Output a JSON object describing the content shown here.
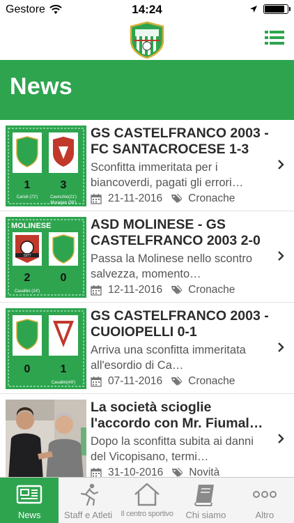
{
  "status_bar": {
    "carrier": "Gestore",
    "time": "14:24",
    "battery_level": 0.9
  },
  "nav_bar": {
    "logo_icon": "club-crest-icon",
    "menu_icon": "list-menu-icon"
  },
  "header": {
    "title": "News"
  },
  "news": [
    {
      "title": "GS CASTELFRANCO 2003 - FC SANTACROCESE  1-3",
      "summary": "Sconfitta immeritata per i biancoverdi, pagati gli errori…",
      "date": "21-11-2016",
      "category": "Cronache",
      "thumb": {
        "left_score": "1",
        "right_score": "3",
        "left_scorer": "Carioli (72')",
        "right_scorer": "Cavicchio(21')",
        "right_scorer_2": "Moragan (56')"
      }
    },
    {
      "title": "ASD MOLINESE - GS CASTELFRANCO 2003  2-0",
      "summary": "Passa la Molinese nello scontro salvezza, momento…",
      "date": "12-11-2016",
      "category": "Cronache",
      "thumb": {
        "left_name": "MOLINESE",
        "left_year": "1977",
        "left_score": "2",
        "right_score": "0",
        "left_scorer": "Cavallini (24')"
      }
    },
    {
      "title": "GS CASTELFRANCO 2003 - CUOIOPELLI  0-1",
      "summary": "Arriva una sconfitta immeritata all'esordio di Ca…",
      "date": "07-11-2016",
      "category": "Cronache",
      "thumb": {
        "left_score": "0",
        "right_score": "1",
        "right_scorer": "Cavallini(49')"
      }
    },
    {
      "title": "La società scioglie l'accordo con Mr. Fiumal…",
      "summary": "Dopo la sconfitta subita ai danni del Vicopisano, termi…",
      "date": "31-10-2016",
      "category": "Novità"
    }
  ],
  "tabs": [
    {
      "label": "News",
      "icon": "newspaper-icon",
      "active": true
    },
    {
      "label": "Staff e Atleti",
      "icon": "runner-icon",
      "active": false
    },
    {
      "label": "Il centro sportivo",
      "icon": "home-icon",
      "active": false
    },
    {
      "label": "Chi siamo",
      "icon": "book-icon",
      "active": false
    },
    {
      "label": "Altro",
      "icon": "more-dots-icon",
      "active": false
    }
  ],
  "colors": {
    "brand_green": "#2ea44f",
    "title_text": "#2b2b2b",
    "body_text": "#555555",
    "tab_inactive": "#8a8a8a"
  }
}
